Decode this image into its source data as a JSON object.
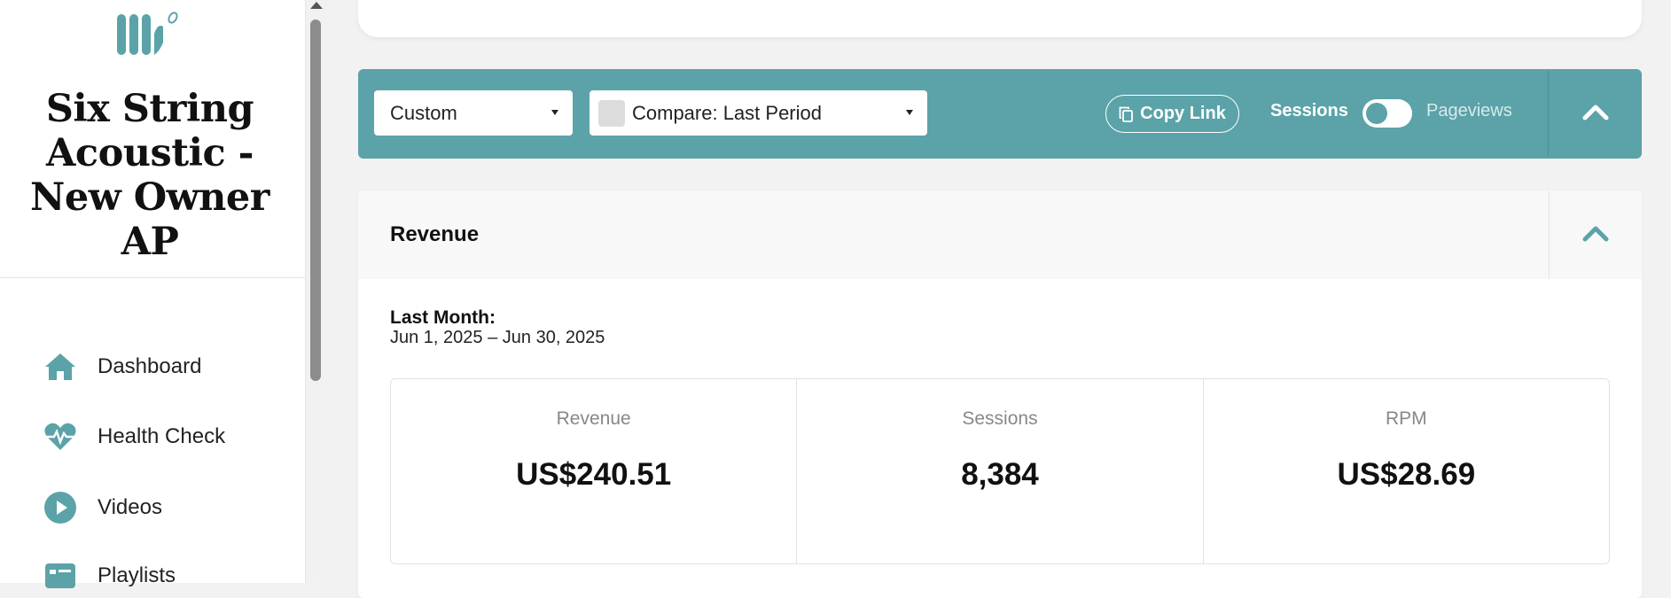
{
  "sidebar": {
    "site_title": "Six String Acoustic - New Owner AP",
    "nav": [
      {
        "label": "Dashboard",
        "icon": "home-icon"
      },
      {
        "label": "Health Check",
        "icon": "heartbeat-icon"
      },
      {
        "label": "Videos",
        "icon": "play-circle-icon"
      },
      {
        "label": "Playlists",
        "icon": "id-card-icon"
      }
    ]
  },
  "filter_bar": {
    "range_select": "Custom",
    "compare_select": "Compare: Last Period",
    "copy_link": "Copy Link",
    "toggle_left": "Sessions",
    "toggle_right": "Pageviews",
    "toggle_state": "Sessions"
  },
  "revenue": {
    "title": "Revenue",
    "period_label": "Last Month:",
    "period_range": "Jun 1, 2025 – Jun 30, 2025",
    "stats": [
      {
        "label": "Revenue",
        "value": "US$240.51"
      },
      {
        "label": "Sessions",
        "value": "8,384"
      },
      {
        "label": "RPM",
        "value": "US$28.69"
      }
    ]
  },
  "colors": {
    "accent": "#5ba3a8",
    "background": "#f2f2f2"
  }
}
